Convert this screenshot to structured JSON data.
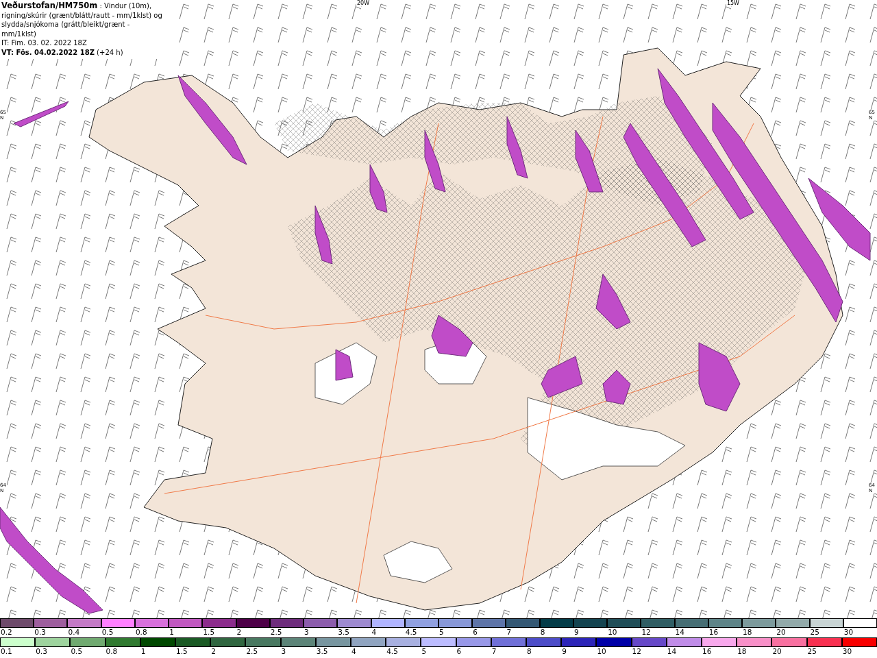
{
  "header": {
    "title": "Veðurstofan/HM750m",
    "description": " : Vindur (10m), rigning/skúrir (grænt/blátt/rautt - mm/1klst) og slydda/snjókoma (grátt/bleikt/grænt - mm/1klst)",
    "issued": "IT: Fim. 03. 02. 2022 18Z",
    "valid_bold": "VT: Fös. 04.02.2022 18Z",
    "valid_offset": "(+24 h)"
  },
  "map": {
    "top_labels": [
      "20W",
      "15W"
    ],
    "left_labels": [
      "65N",
      "64N"
    ],
    "right_labels": [
      "65N",
      "64N"
    ]
  },
  "legends": [
    {
      "items": [
        {
          "label": "0.2",
          "color": "#6e4a6b"
        },
        {
          "label": "0.3",
          "color": "#9e5e9e"
        },
        {
          "label": "0.4",
          "color": "#c47ac6"
        },
        {
          "label": "0.5",
          "color": "#ff80ff"
        },
        {
          "label": "0.8",
          "color": "#d870dc"
        },
        {
          "label": "1",
          "color": "#c058c0"
        },
        {
          "label": "1.5",
          "color": "#8c2c8c"
        },
        {
          "label": "2",
          "color": "#4e0048"
        },
        {
          "label": "2.5",
          "color": "#6e2c7c"
        },
        {
          "label": "3",
          "color": "#8c5cac"
        },
        {
          "label": "3.5",
          "color": "#9e8ad0"
        },
        {
          "label": "4",
          "color": "#b0b4ff"
        },
        {
          "label": "4.5",
          "color": "#90a0e0"
        },
        {
          "label": "5",
          "color": "#8898d8"
        },
        {
          "label": "6",
          "color": "#5e74a8"
        },
        {
          "label": "7",
          "color": "#345874"
        },
        {
          "label": "8",
          "color": "#043c48"
        },
        {
          "label": "9",
          "color": "#144450"
        },
        {
          "label": "10",
          "color": "#204e58"
        },
        {
          "label": "12",
          "color": "#305e64"
        },
        {
          "label": "14",
          "color": "#466e74"
        },
        {
          "label": "16",
          "color": "#5e8488"
        },
        {
          "label": "18",
          "color": "#7c9a9c"
        },
        {
          "label": "20",
          "color": "#92aaaa"
        },
        {
          "label": "25",
          "color": "#c8d4d4"
        },
        {
          "label": "30",
          "color": "#ffffff"
        }
      ]
    },
    {
      "items": [
        {
          "label": "0.1",
          "color": "#ccffcc"
        },
        {
          "label": "0.3",
          "color": "#9ed49e"
        },
        {
          "label": "0.5",
          "color": "#70aa70"
        },
        {
          "label": "0.8",
          "color": "#307a30"
        },
        {
          "label": "1",
          "color": "#004800"
        },
        {
          "label": "1.5",
          "color": "#1a5a24"
        },
        {
          "label": "2",
          "color": "#306640"
        },
        {
          "label": "2.5",
          "color": "#487860"
        },
        {
          "label": "3",
          "color": "#5c8478"
        },
        {
          "label": "3.5",
          "color": "#7896a0"
        },
        {
          "label": "4",
          "color": "#90a4c0"
        },
        {
          "label": "4.5",
          "color": "#a8b0e0"
        },
        {
          "label": "5",
          "color": "#bcbcff"
        },
        {
          "label": "6",
          "color": "#9898e8"
        },
        {
          "label": "7",
          "color": "#7070d8"
        },
        {
          "label": "8",
          "color": "#4c4cc8"
        },
        {
          "label": "9",
          "color": "#2c24b8"
        },
        {
          "label": "10",
          "color": "#0000a8"
        },
        {
          "label": "12",
          "color": "#6648c8"
        },
        {
          "label": "14",
          "color": "#c08ce8"
        },
        {
          "label": "16",
          "color": "#f8a8ec"
        },
        {
          "label": "18",
          "color": "#f890c8"
        },
        {
          "label": "20",
          "color": "#f870a0"
        },
        {
          "label": "25",
          "color": "#f83050"
        },
        {
          "label": "30",
          "color": "#f80000"
        }
      ]
    }
  ]
}
